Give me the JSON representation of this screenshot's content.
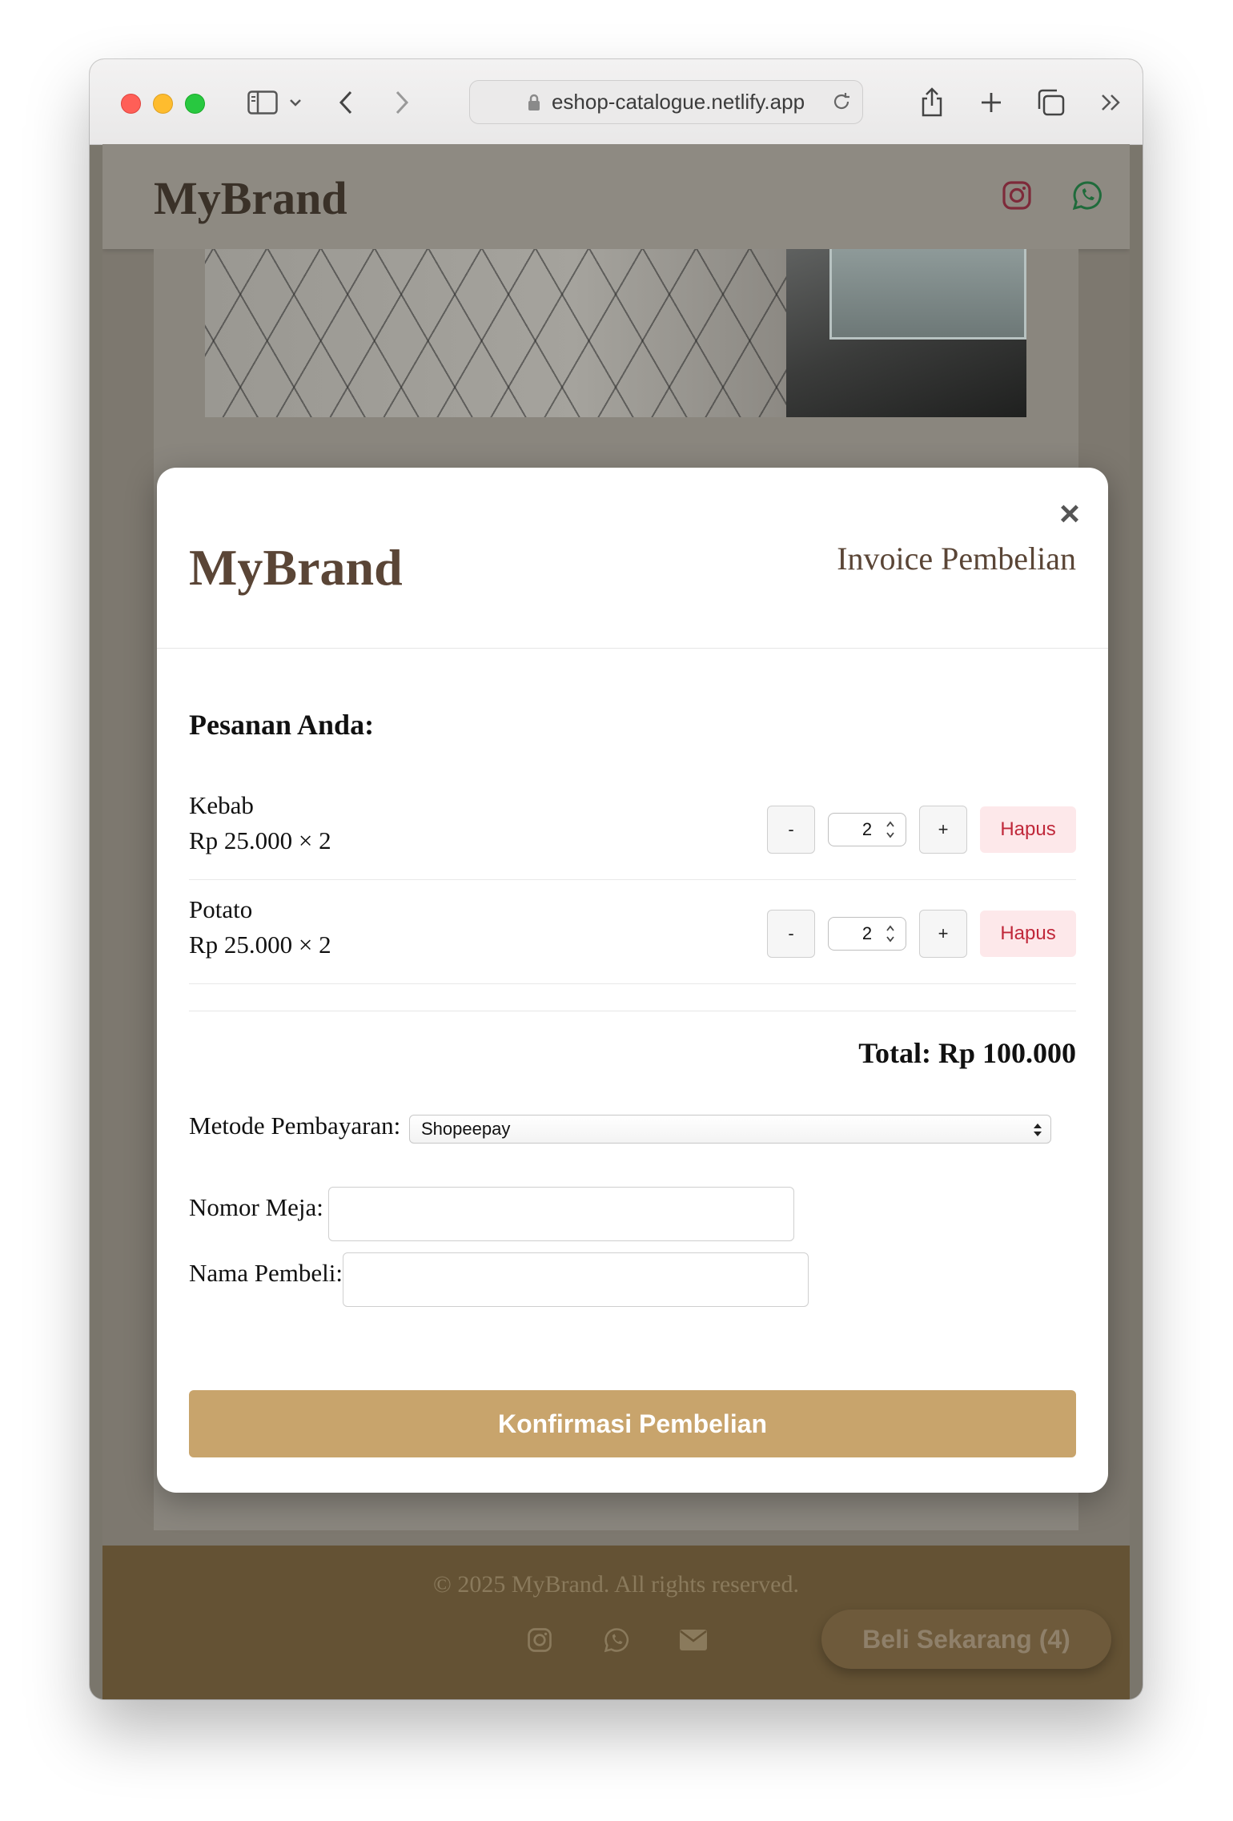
{
  "browser": {
    "url": "eshop-catalogue.netlify.app"
  },
  "site": {
    "brand": "MyBrand",
    "footer_copyright": "© 2025 MyBrand. All rights reserved.",
    "buy_now_label": "Beli Sekarang (4)"
  },
  "modal": {
    "brand": "MyBrand",
    "title": "Invoice Pembelian",
    "close_label": "×",
    "section_title": "Pesanan Anda:",
    "items": [
      {
        "name": "Kebab",
        "price_line": "Rp 25.000 × 2",
        "qty": "2",
        "minus": "-",
        "plus": "+",
        "remove": "Hapus"
      },
      {
        "name": "Potato",
        "price_line": "Rp 25.000 × 2",
        "qty": "2",
        "minus": "-",
        "plus": "+",
        "remove": "Hapus"
      }
    ],
    "total": "Total: Rp 100.000",
    "payment_label": "Metode Pembayaran:",
    "payment_value": "Shopeepay",
    "table_label": "Nomor Meja:",
    "table_value": "",
    "buyer_label": "Nama Pembeli:",
    "buyer_value": "",
    "confirm_label": "Konfirmasi Pembelian"
  },
  "colors": {
    "brand_brown": "#5a4536",
    "confirm_button": "#c8a46c",
    "remove_text": "#c0283a",
    "remove_bg": "#fde8ea",
    "footer_bg": "#645234"
  },
  "icons": {
    "header": [
      "instagram-icon",
      "whatsapp-icon"
    ],
    "footer": [
      "instagram-icon",
      "whatsapp-icon",
      "envelope-icon"
    ]
  }
}
